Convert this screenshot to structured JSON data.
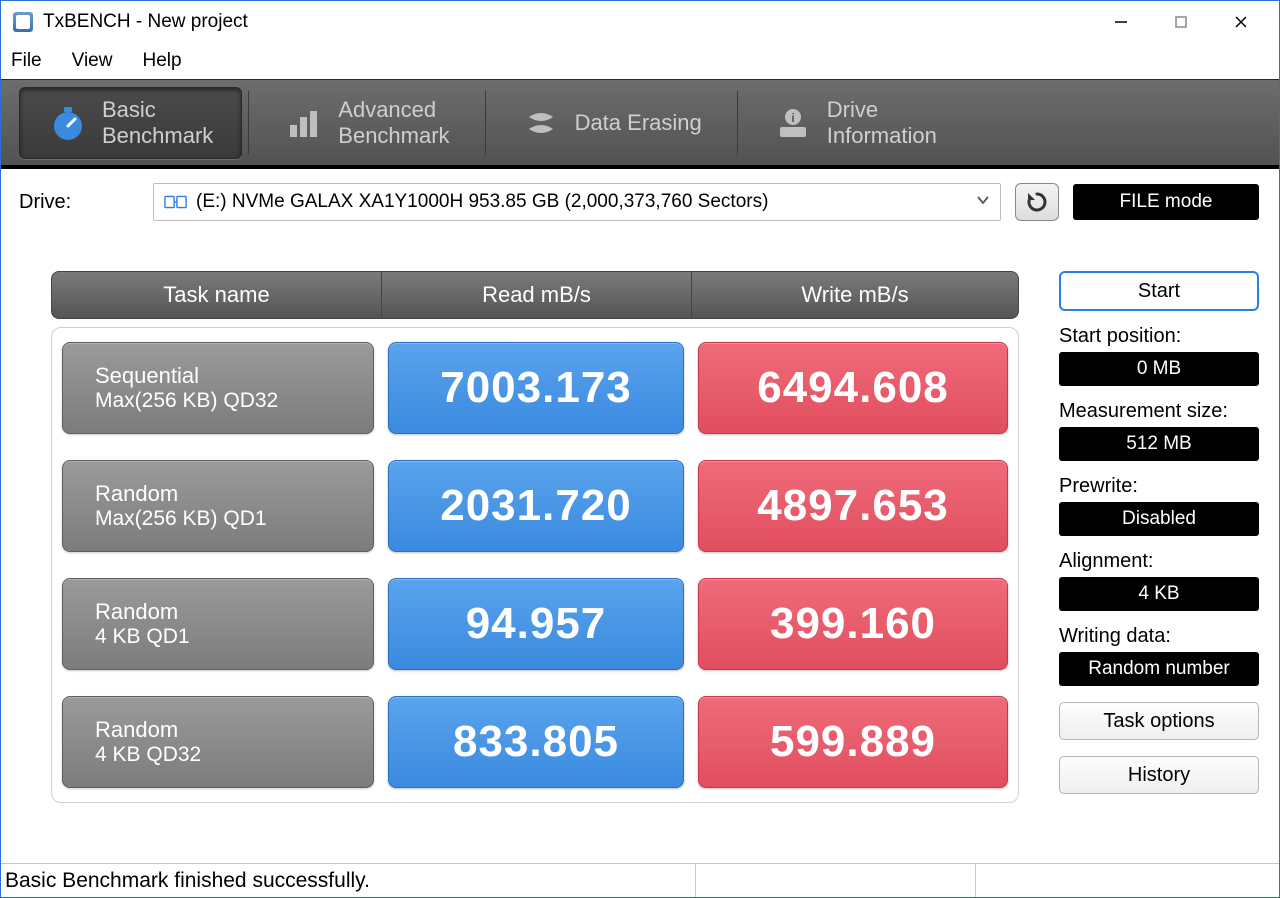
{
  "window": {
    "title": "TxBENCH - New project"
  },
  "menu": {
    "file": "File",
    "view": "View",
    "help": "Help"
  },
  "tabs": {
    "basic": {
      "line1": "Basic",
      "line2": "Benchmark"
    },
    "advanced": {
      "line1": "Advanced",
      "line2": "Benchmark"
    },
    "erasing": {
      "label": "Data Erasing"
    },
    "info": {
      "line1": "Drive",
      "line2": "Information"
    }
  },
  "drive": {
    "label": "Drive:",
    "value": "(E:) NVMe GALAX XA1Y1000H  953.85 GB (2,000,373,760 Sectors)"
  },
  "mode_button": "FILE mode",
  "headers": {
    "task": "Task name",
    "read": "Read mB/s",
    "write": "Write mB/s"
  },
  "rows": [
    {
      "title": "Sequential",
      "sub": "Max(256 KB) QD32",
      "read": "7003.173",
      "write": "6494.608"
    },
    {
      "title": "Random",
      "sub": "Max(256 KB) QD1",
      "read": "2031.720",
      "write": "4897.653"
    },
    {
      "title": "Random",
      "sub": "4 KB QD1",
      "read": "94.957",
      "write": "399.160"
    },
    {
      "title": "Random",
      "sub": "4 KB QD32",
      "read": "833.805",
      "write": "599.889"
    }
  ],
  "side": {
    "start": "Start",
    "start_pos_label": "Start position:",
    "start_pos": "0 MB",
    "meas_label": "Measurement size:",
    "meas": "512 MB",
    "prewrite_label": "Prewrite:",
    "prewrite": "Disabled",
    "align_label": "Alignment:",
    "align": "4 KB",
    "wdata_label": "Writing data:",
    "wdata": "Random number",
    "task_options": "Task options",
    "history": "History"
  },
  "status": "Basic Benchmark finished successfully."
}
